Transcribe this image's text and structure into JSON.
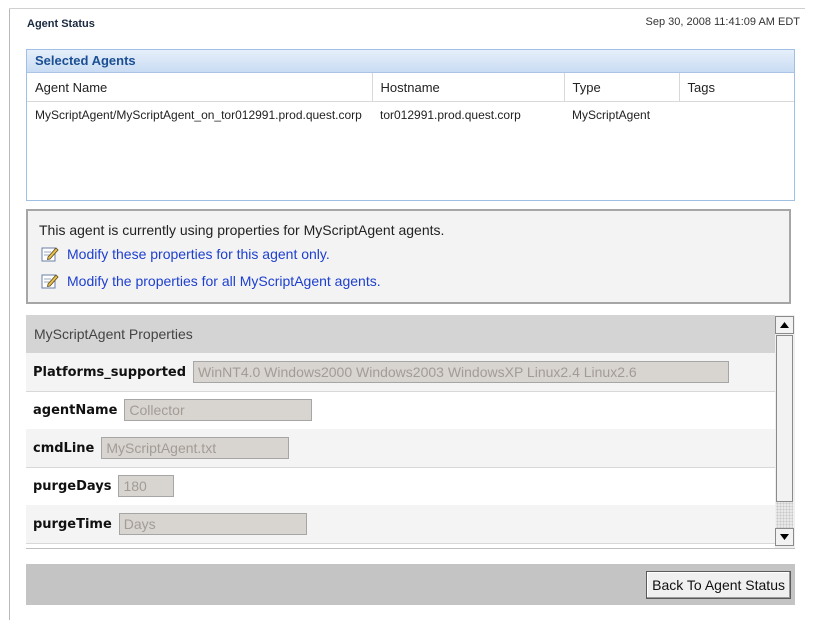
{
  "page": {
    "title": "Agent Status",
    "timestamp": "Sep 30, 2008 11:41:09 AM EDT"
  },
  "selected_agents": {
    "title": "Selected Agents",
    "columns": [
      "Agent Name",
      "Hostname",
      "Type",
      "Tags"
    ],
    "rows": [
      [
        "MyScriptAgent/MyScriptAgent_on_tor012991.prod.quest.corp",
        "tor012991.prod.quest.corp",
        "MyScriptAgent",
        ""
      ]
    ]
  },
  "info": {
    "message": "This agent is currently using properties for MyScriptAgent agents.",
    "link_this_agent": "Modify these properties for this agent only.",
    "link_all_agents": "Modify the properties for all MyScriptAgent agents."
  },
  "properties": {
    "title": "MyScriptAgent Properties",
    "fields": [
      {
        "label": "Platforms_supported",
        "value": "WinNT4.0 Windows2000 Windows2003 WindowsXP Linux2.4 Linux2.6"
      },
      {
        "label": "agentName",
        "value": "Collector"
      },
      {
        "label": "cmdLine",
        "value": "MyScriptAgent.txt"
      },
      {
        "label": "purgeDays",
        "value": "180"
      },
      {
        "label": "purgeTime",
        "value": "Days"
      }
    ]
  },
  "footer": {
    "back_label": "Back To Agent Status"
  },
  "icons": {
    "edit": "pencil-edit-icon",
    "scroll_up": "scroll-up-arrow-icon",
    "scroll_down": "scroll-down-arrow-icon"
  },
  "colors": {
    "link": "#1d3fcf",
    "panel_header": "#1b4f93",
    "disabled_field": "#d8d4cf"
  }
}
